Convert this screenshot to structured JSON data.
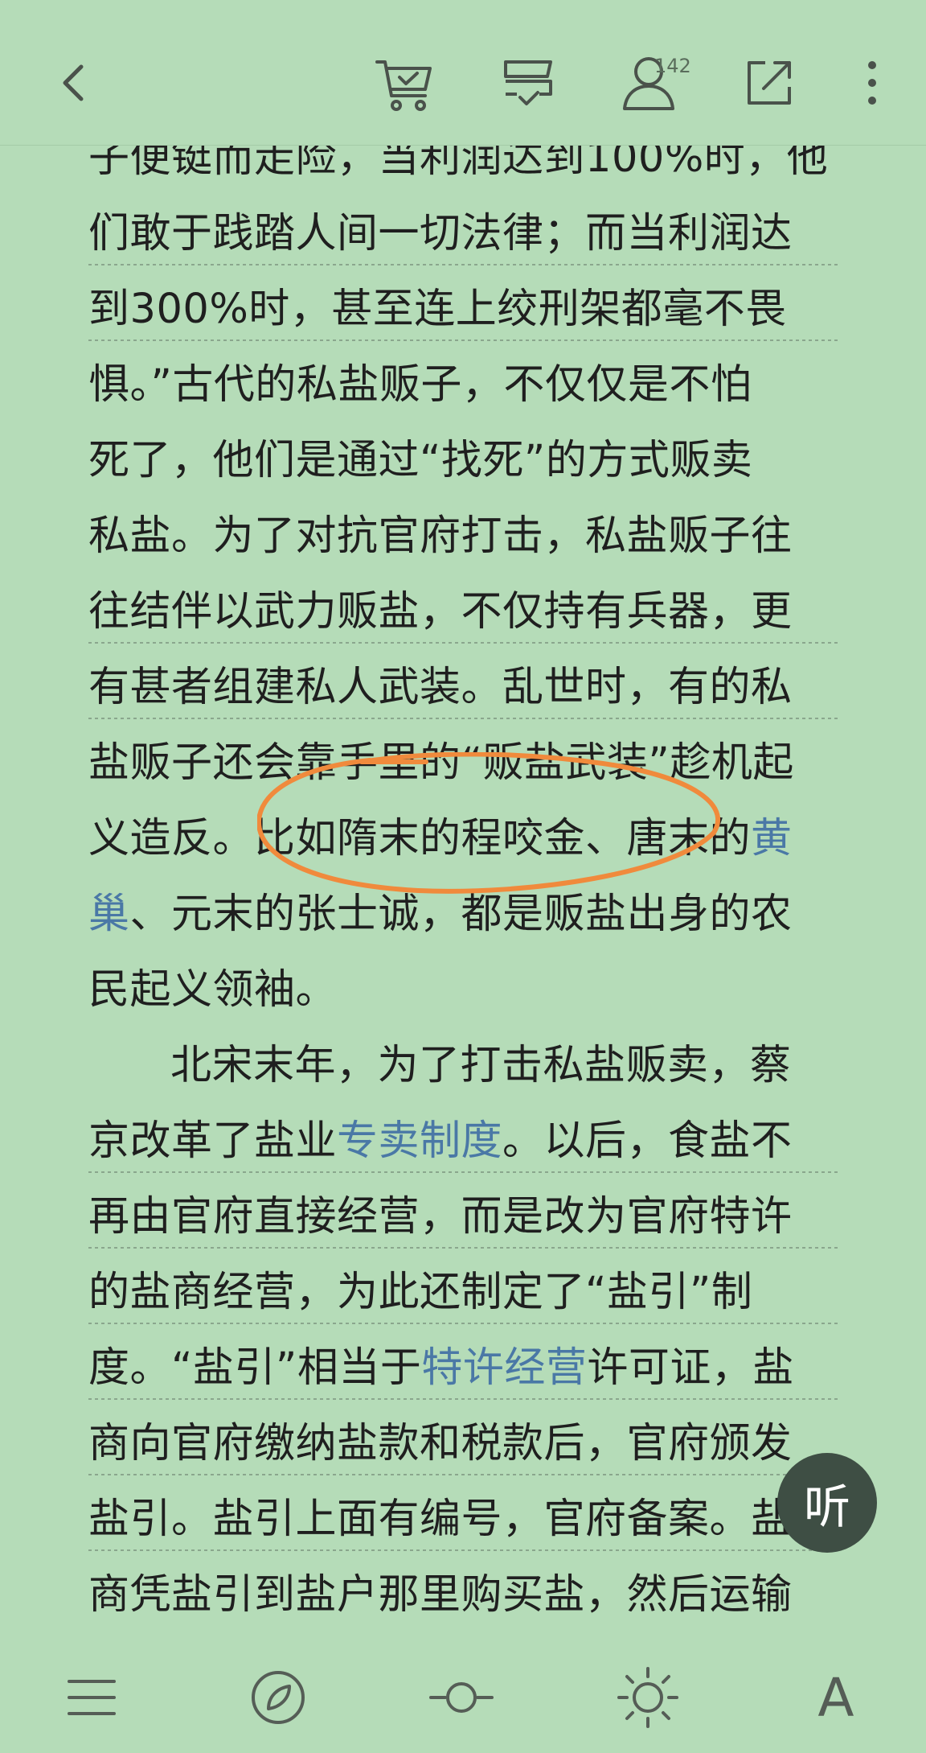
{
  "topbar": {
    "back_icon": "chevron-left-icon",
    "cart_icon": "cart-check-icon",
    "shelf_icon": "bookshelf-check-icon",
    "user_icon": "user-icon",
    "user_count": "142",
    "share_icon": "share-out-icon",
    "more_icon": "more-vertical-icon"
  },
  "content": {
    "line0": "子便铤而走险，当利润达到100%时，他",
    "line1": "们敢于践踏人间一切法律；而当利润达",
    "line2": "到300%时，甚至连上绞刑架都毫不畏",
    "line3": "惧。”古代的私盐贩子，不仅仅是不怕",
    "line4": "死了，他们是通过“找死”的方式贩卖",
    "line5": "私盐。为了对抗官府打击，私盐贩子往",
    "line6": "往结伴以武力贩盐，不仅持有兵器，更",
    "line7": "有甚者组建私人武装。乱世时，有的私",
    "line8": "盐贩子还会靠手里的“贩盐武装”趁机起",
    "line9_a": "义造反。比如隋末的程咬金、唐末的",
    "line9_link": "黄",
    "line10_link": "巢",
    "line10_b": "、元末的张士诚，都是贩盐出身的农",
    "line11": "民起义领袖。",
    "line12": "北宋末年，为了打击私盐贩卖，蔡",
    "line13_a": "京改革了盐业",
    "line13_link": "专卖制度",
    "line13_b": "。以后，食盐不",
    "line14": "再由官府直接经营，而是改为官府特许",
    "line15": "的盐商经营，为此还制定了“盐引”制",
    "line16_a": "度。“盐引”相当于",
    "line16_link": "特许经营",
    "line16_b": "许可证，盐",
    "line17": "商向官府缴纳盐款和税款后，官府颁发",
    "line18": "盐引。盐引上面有编号，官府备案。盐",
    "line19": "商凭盐引到盐户那里购买盐，然后运输"
  },
  "listen_button": {
    "label": "听"
  },
  "bottombar": {
    "menu_icon": "menu-icon",
    "compass_icon": "compass-icon",
    "progress_icon": "progress-icon",
    "brightness_icon": "brightness-icon",
    "font_label": "A"
  },
  "colors": {
    "background": "#b5dcb8",
    "link": "#4a78a6",
    "annotation": "#f08a3c",
    "listen_button": "#3e4e44"
  }
}
